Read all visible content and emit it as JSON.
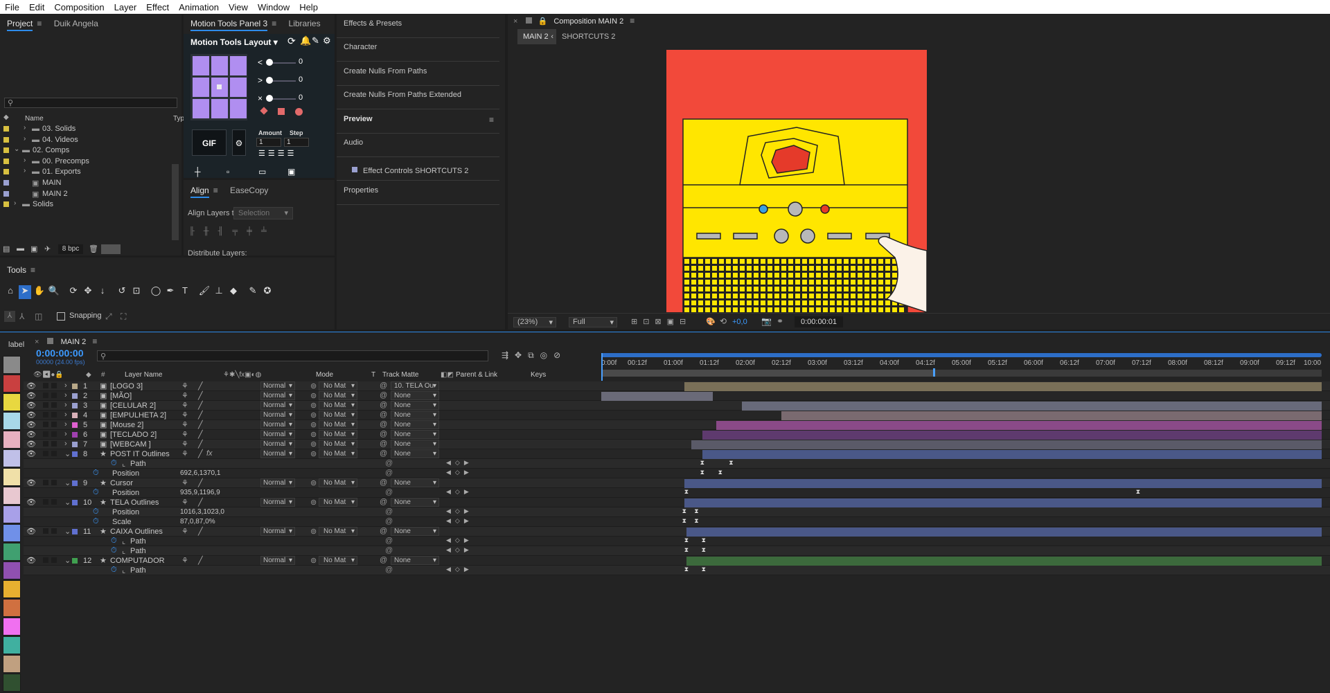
{
  "menu": [
    "File",
    "Edit",
    "Composition",
    "Layer",
    "Effect",
    "Animation",
    "View",
    "Window",
    "Help"
  ],
  "project_panel": {
    "tabs": [
      "Project",
      "Duik Angela"
    ],
    "search_placeholder": "",
    "col_name": "Name",
    "col_type": "Typ",
    "items": [
      {
        "label": "03. Solids",
        "indent": 1,
        "type": "folder",
        "color": "#d8c040"
      },
      {
        "label": "04. Videos",
        "indent": 1,
        "type": "folder",
        "color": "#d8c040"
      },
      {
        "label": "02. Comps",
        "indent": 0,
        "type": "folder-open",
        "color": "#d8c040"
      },
      {
        "label": "00. Precomps",
        "indent": 1,
        "type": "folder",
        "color": "#d8c040"
      },
      {
        "label": "01. Exports",
        "indent": 1,
        "type": "folder",
        "color": "#d8c040"
      },
      {
        "label": "MAIN",
        "indent": 1,
        "type": "comp",
        "color": "#9aa0d0"
      },
      {
        "label": "MAIN 2",
        "indent": 1,
        "type": "comp",
        "color": "#9aa0d0"
      },
      {
        "label": "Solids",
        "indent": 0,
        "type": "folder",
        "color": "#d8c040"
      }
    ],
    "bpc": "8 bpc"
  },
  "motion_tools": {
    "tabs": [
      "Motion Tools Panel 3",
      "Libraries"
    ],
    "layout_title": "Motion Tools Layout",
    "sliders": [
      {
        "icon": "<",
        "value": "0"
      },
      {
        "icon": ">",
        "value": "0"
      },
      {
        "icon": "×",
        "value": "0"
      }
    ],
    "gif_label": "GIF",
    "amount_label": "Amount",
    "step_label": "Step",
    "amount_value": "1",
    "step_value": "1"
  },
  "align_panel": {
    "tabs": [
      "Align",
      "EaseCopy"
    ],
    "align_to_label": "Align Layers to:",
    "align_to_value": "Selection",
    "distribute_label": "Distribute Layers:"
  },
  "tools_panel": {
    "title": "Tools",
    "snapping": "Snapping"
  },
  "right_panel": {
    "items": [
      "Effects & Presets",
      "Character",
      "Create Nulls From Paths",
      "Create Nulls From Paths Extended",
      "Preview",
      "Audio",
      "Effect Controls SHORTCUTS 2",
      "Properties"
    ]
  },
  "composition": {
    "title": "Composition MAIN 2",
    "tabs": [
      "MAIN 2",
      "SHORTCUTS 2"
    ],
    "zoom": "(23%)",
    "quality": "Full",
    "exposure": "+0,0",
    "timecode": "0:00:00:01"
  },
  "timeline": {
    "label_tab": "label",
    "comp_tab": "MAIN 2",
    "timecode": "0:00:00:00",
    "fps": "00000 (24.00 fps)",
    "headers": {
      "layer_name": "Layer Name",
      "mode": "Mode",
      "t": "T",
      "track_matte": "Track Matte",
      "parent": "Parent & Link",
      "keys": "Keys"
    },
    "ruler": [
      "0:00f",
      "00:12f",
      "01:00f",
      "01:12f",
      "02:00f",
      "02:12f",
      "03:00f",
      "03:12f",
      "04:00f",
      "04:12f",
      "05:00f",
      "05:12f",
      "06:00f",
      "06:12f",
      "07:00f",
      "07:12f",
      "08:00f",
      "08:12f",
      "09:00f",
      "09:12f",
      "10:00"
    ],
    "label_colors": [
      "#8a8a8a",
      "#c94040",
      "#e8d840",
      "#a8d8e8",
      "#e8b0c0",
      "#c0c0e8",
      "#f0e0a8",
      "#e8c8d0",
      "#a8a0e8",
      "#7090e8",
      "#40a070",
      "#9050b0",
      "#e8b030",
      "#d07040",
      "#f070f0",
      "#40b0a0",
      "#c0a080",
      "#305030"
    ],
    "layers": [
      {
        "num": "1",
        "name": "[LOGO 3]",
        "type": "comp",
        "color": "#b8a888",
        "mode": "Normal",
        "matte": "No Mat",
        "parent": "10. TELA Ou",
        "expanded": false,
        "bar_color": "#7a7058",
        "bar_start": 0.115,
        "bar_end": 1.0
      },
      {
        "num": "2",
        "name": "[MÃO]",
        "type": "comp",
        "color": "#9aa0d0",
        "mode": "Normal",
        "matte": "No Mat",
        "parent": "None",
        "expanded": false,
        "bar_color": "#6a6a78",
        "bar_start": 0.0,
        "bar_end": 0.155
      },
      {
        "num": "3",
        "name": "[CELULAR 2]",
        "type": "comp",
        "color": "#9aa0d0",
        "mode": "Normal",
        "matte": "No Mat",
        "parent": "None",
        "expanded": false,
        "bar_color": "#686a7a",
        "bar_start": 0.195,
        "bar_end": 1.0
      },
      {
        "num": "4",
        "name": "[EMPULHETA 2]",
        "type": "comp",
        "color": "#d8b0b8",
        "mode": "Normal",
        "matte": "No Mat",
        "parent": "None",
        "expanded": false,
        "bar_color": "#7a6a70",
        "bar_start": 0.25,
        "bar_end": 1.0
      },
      {
        "num": "5",
        "name": "[Mouse 2]",
        "type": "comp",
        "color": "#e060d0",
        "mode": "Normal",
        "matte": "No Mat",
        "parent": "None",
        "expanded": false,
        "bar_color": "#8a4a88",
        "bar_start": 0.16,
        "bar_end": 1.0
      },
      {
        "num": "6",
        "name": "[TECLADO 2]",
        "type": "comp",
        "color": "#a040b0",
        "mode": "Normal",
        "matte": "No Mat",
        "parent": "None",
        "expanded": false,
        "bar_color": "#5e3a6e",
        "bar_start": 0.14,
        "bar_end": 1.0
      },
      {
        "num": "7",
        "name": "[WEBCAM ]",
        "type": "comp",
        "color": "#9aa0d0",
        "mode": "Normal",
        "matte": "No Mat",
        "parent": "None",
        "expanded": false,
        "bar_color": "#5a5a68",
        "bar_start": 0.125,
        "bar_end": 1.0
      },
      {
        "num": "8",
        "name": "POST IT Outlines",
        "type": "shape",
        "color": "#6070d0",
        "mode": "Normal",
        "matte": "No Mat",
        "parent": "None",
        "expanded": true,
        "fx": true,
        "bar_color": "#4a5888",
        "bar_start": 0.14,
        "bar_end": 1.0,
        "props": [
          {
            "name": "Path",
            "value": "",
            "keys": [
              0.14,
              0.18
            ],
            "indent": 2
          },
          {
            "name": "Position",
            "value": "692,6,1370,1",
            "keys": [
              0.14,
              0.165
            ],
            "indent": 1
          }
        ]
      },
      {
        "num": "9",
        "name": "Cursor",
        "type": "shape",
        "color": "#6070d0",
        "mode": "Normal",
        "matte": "No Mat",
        "parent": "None",
        "expanded": true,
        "bar_color": "#4a5888",
        "bar_start": 0.115,
        "bar_end": 1.0,
        "props": [
          {
            "name": "Position",
            "value": "935,9,1196,9",
            "keys": [
              0.118,
              0.745
            ],
            "indent": 1
          }
        ]
      },
      {
        "num": "10",
        "name": "TELA Outlines",
        "type": "shape",
        "color": "#6070d0",
        "mode": "Normal",
        "matte": "No Mat",
        "parent": "None",
        "expanded": true,
        "bar_color": "#4a5888",
        "bar_start": 0.115,
        "bar_end": 1.0,
        "props": [
          {
            "name": "Position",
            "value": "1016,3,1023,0",
            "keys": [
              0.115,
              0.132
            ],
            "indent": 1
          },
          {
            "name": "Scale",
            "value": "87,0,87,0%",
            "keys": [
              0.115,
              0.132
            ],
            "indent": 1
          }
        ]
      },
      {
        "num": "11",
        "name": "CAIXA Outlines",
        "type": "shape",
        "color": "#6070d0",
        "mode": "Normal",
        "matte": "No Mat",
        "parent": "None",
        "expanded": true,
        "bar_color": "#4a5888",
        "bar_start": 0.118,
        "bar_end": 1.0,
        "props": [
          {
            "name": "Path",
            "value": "",
            "keys": [
              0.118,
              0.142
            ],
            "indent": 2
          },
          {
            "name": "Path",
            "value": "",
            "keys": [
              0.118,
              0.142
            ],
            "indent": 2
          }
        ]
      },
      {
        "num": "12",
        "name": "COMPUTADOR",
        "type": "shape",
        "color": "#40a050",
        "mode": "Normal",
        "matte": "No Mat",
        "parent": "None",
        "expanded": true,
        "bar_color": "#3c6a3c",
        "bar_start": 0.118,
        "bar_end": 1.0,
        "props": [
          {
            "name": "Path",
            "value": "",
            "keys": [
              0.118,
              0.142
            ],
            "indent": 2
          }
        ]
      }
    ]
  }
}
